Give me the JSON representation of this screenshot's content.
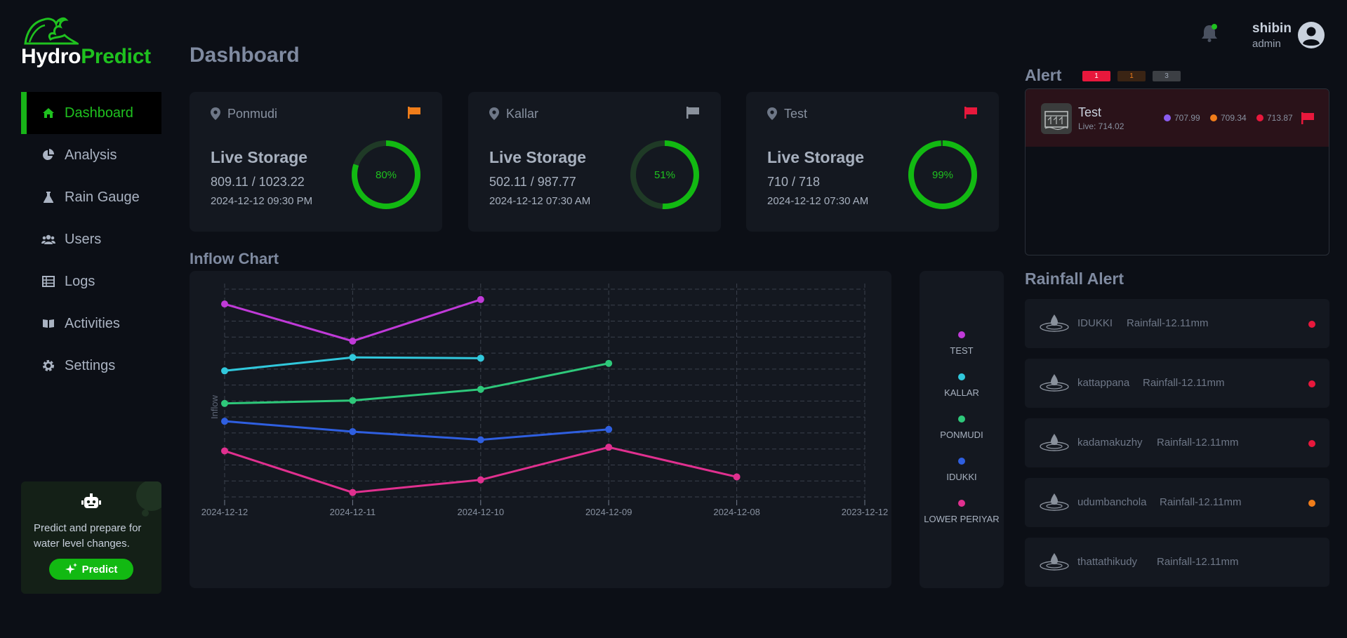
{
  "brand": {
    "part1": "Hydro",
    "part2": "Predict"
  },
  "nav": {
    "items": [
      {
        "label": "Dashboard",
        "icon": "home-icon",
        "active": true
      },
      {
        "label": "Analysis",
        "icon": "pie-chart-icon"
      },
      {
        "label": "Rain Gauge",
        "icon": "flask-icon"
      },
      {
        "label": "Users",
        "icon": "users-icon"
      },
      {
        "label": "Logs",
        "icon": "table-icon"
      },
      {
        "label": "Activities",
        "icon": "book-icon"
      },
      {
        "label": "Settings",
        "icon": "gear-icon"
      }
    ]
  },
  "promo": {
    "text": "Predict and prepare for water level changes.",
    "button": "Predict"
  },
  "header": {
    "title": "Dashboard",
    "user_name": "shibin",
    "user_role": "admin"
  },
  "cards": [
    {
      "location": "Ponmudi",
      "heading": "Live Storage",
      "value": "809.11 / 1023.22",
      "time": "2024-12-12 09:30 PM",
      "percent": 80,
      "percent_label": "80%",
      "flag_color": "#f07d1a"
    },
    {
      "location": "Kallar",
      "heading": "Live Storage",
      "value": "502.11 / 987.77",
      "time": "2024-12-12 07:30 AM",
      "percent": 51,
      "percent_label": "51%",
      "flag_color": "#8a919c"
    },
    {
      "location": "Test",
      "heading": "Live Storage",
      "value": "710 / 718",
      "time": "2024-12-12 07:30 AM",
      "percent": 99,
      "percent_label": "99%",
      "flag_color": "#e8183c"
    }
  ],
  "inflow": {
    "title": "Inflow Chart"
  },
  "chart_data": {
    "type": "line",
    "ylabel": "Inflow",
    "categories": [
      "2024-12-12",
      "2024-12-11",
      "2024-12-10",
      "2024-12-09",
      "2024-12-08",
      "2023-12-12"
    ],
    "ylim": [
      0,
      14
    ],
    "grid": true,
    "legend_position": "right",
    "series": [
      {
        "name": "TEST",
        "color": "#c03ad8",
        "values": [
          13.0,
          10.5,
          13.3,
          null,
          null,
          null
        ]
      },
      {
        "name": "KALLAR",
        "color": "#31c8dc",
        "values": [
          8.5,
          9.4,
          9.35,
          null,
          null,
          null
        ]
      },
      {
        "name": "PONMUDI",
        "color": "#2ec87a",
        "values": [
          6.3,
          6.5,
          7.25,
          9.0,
          null,
          null
        ]
      },
      {
        "name": "IDUKKI",
        "color": "#2f5fe0",
        "values": [
          5.1,
          4.4,
          3.85,
          4.55,
          null,
          null
        ]
      },
      {
        "name": "LOWER PERIYAR",
        "color": "#e0308f",
        "values": [
          3.1,
          0.3,
          1.15,
          3.35,
          1.35,
          null
        ]
      }
    ]
  },
  "alert": {
    "title": "Alert",
    "badges": [
      {
        "label": "1",
        "bg": "#e8183c",
        "fg": "#ffffff"
      },
      {
        "label": "1",
        "bg": "#3a2414",
        "fg": "#f07d1a"
      },
      {
        "label": "3",
        "bg": "#3c3f44",
        "fg": "#9aa3b2"
      }
    ],
    "item": {
      "name": "Test",
      "live": "Live: 714.02",
      "levels": [
        {
          "value": "707.99",
          "color": "#8a5cf0"
        },
        {
          "value": "709.34",
          "color": "#f07d1a"
        },
        {
          "value": "713.87",
          "color": "#e8183c"
        }
      ]
    }
  },
  "rainfall": {
    "title": "Rainfall Alert",
    "items": [
      {
        "place": "IDUKKI",
        "rain": "Rainfall-12.11mm",
        "status_color": "#e8183c"
      },
      {
        "place": "kattappana",
        "rain": "Rainfall-12.11mm",
        "status_color": "#e8183c"
      },
      {
        "place": "kadamakuzhy",
        "rain": "Rainfall-12.11mm",
        "status_color": "#e8183c"
      },
      {
        "place": "udumbanchola",
        "rain": "Rainfall-12.11mm",
        "status_color": "#f07d1a"
      },
      {
        "place": "thattathikudy",
        "rain": "Rainfall-12.11mm",
        "status_color": ""
      }
    ]
  }
}
